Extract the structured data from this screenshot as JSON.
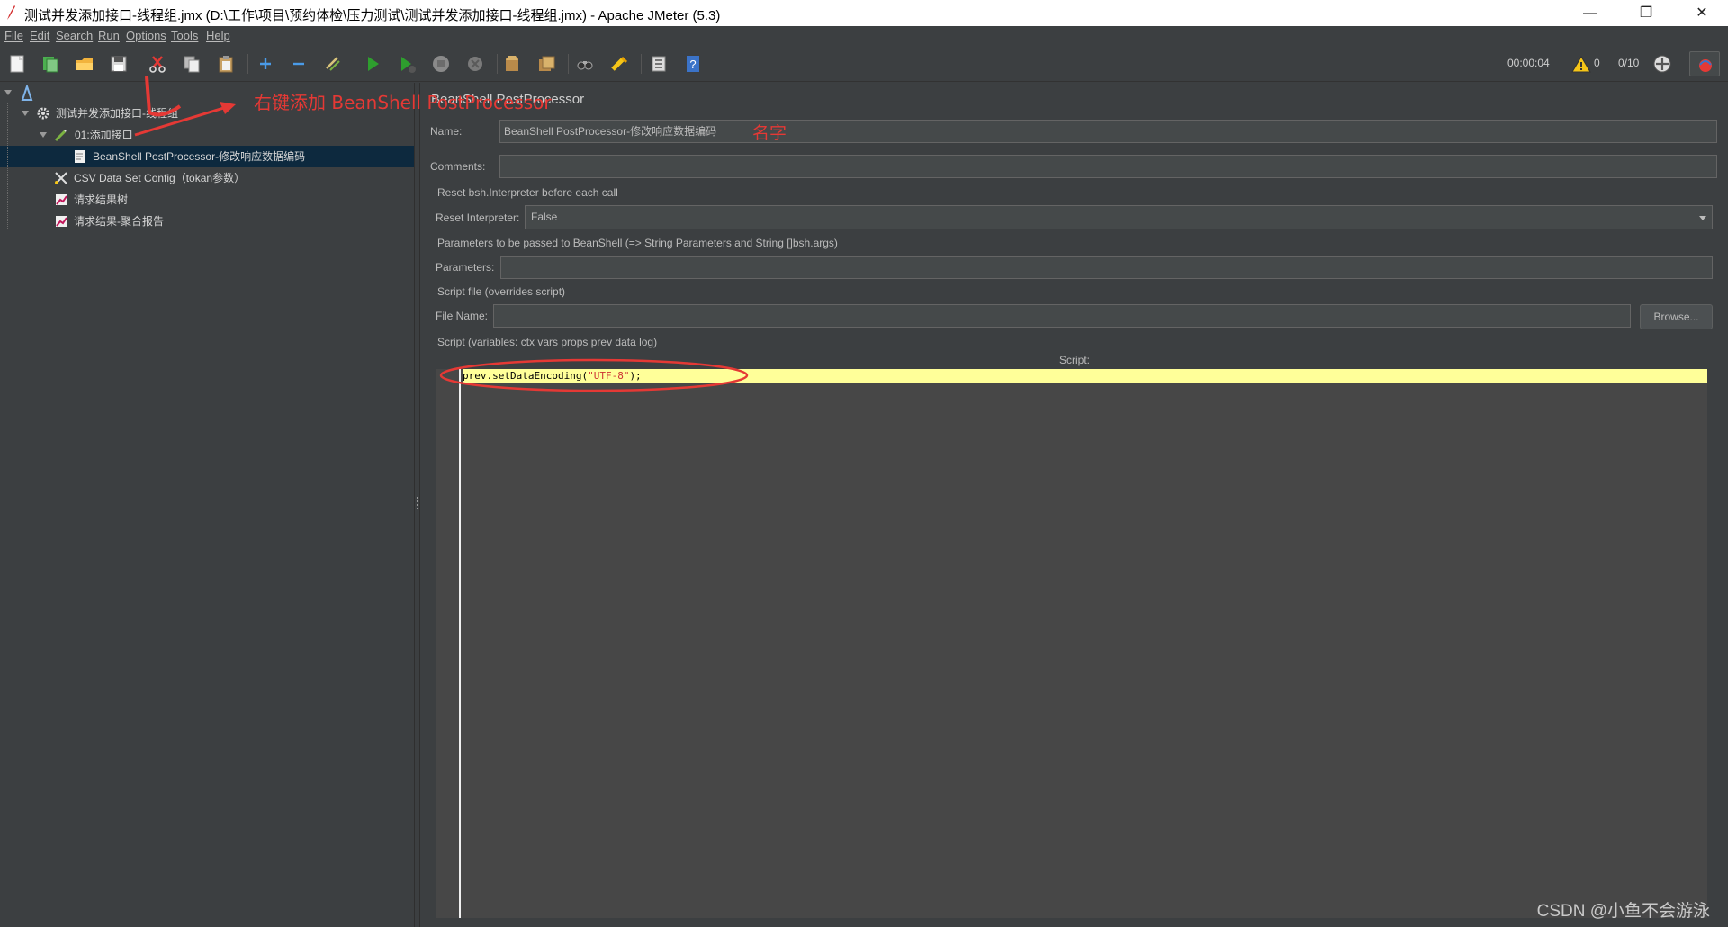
{
  "window": {
    "title": "测试并发添加接口-线程组.jmx (D:\\工作\\项目\\预约体检\\压力测试\\测试并发添加接口-线程组.jmx) - Apache JMeter (5.3)",
    "minimize_glyph": "—",
    "maximize_glyph": "❐",
    "close_glyph": "✕"
  },
  "menu": [
    "File",
    "Edit",
    "Search",
    "Run",
    "Options",
    "Tools",
    "Help"
  ],
  "toolbar": {
    "icons": [
      "new-icon",
      "templates-icon",
      "open-icon",
      "save-icon",
      "cut-icon",
      "copy-icon",
      "paste-icon",
      "expand-icon",
      "collapse-icon",
      "toggle-icon",
      "start-icon",
      "start-no-pause-icon",
      "stop-icon",
      "shutdown-icon",
      "clear-icon",
      "clear-all-icon",
      "search-icon",
      "reset-search-icon",
      "function-helper-icon",
      "help-icon"
    ],
    "timer": "00:00:04",
    "warnings": "0",
    "threads": "0/10"
  },
  "tree": {
    "root_icon": "test-plan-icon",
    "items": [
      {
        "label": "测试并发添加接口-线程组",
        "icon": "gear-icon"
      },
      {
        "label": "01:添加接口",
        "icon": "sampler-pencil-icon"
      },
      {
        "label": "BeanShell PostProcessor-修改响应数据编码",
        "icon": "postprocessor-doc-icon"
      },
      {
        "label": "CSV Data Set Config（tokan参数）",
        "icon": "config-scissors-icon"
      },
      {
        "label": "请求结果树",
        "icon": "listener-chart-icon"
      },
      {
        "label": "请求结果-聚合报告",
        "icon": "listener-chart-icon"
      }
    ]
  },
  "panel": {
    "heading": "BeanShell PostProcessor",
    "name_label": "Name:",
    "name_value": "BeanShell PostProcessor-修改响应数据编码",
    "comments_label": "Comments:",
    "comments_value": "",
    "reset_section": "Reset bsh.Interpreter before each call",
    "reset_label": "Reset Interpreter:",
    "reset_value": "False",
    "params_section": "Parameters to be passed to BeanShell (=> String Parameters and String []bsh.args)",
    "params_label": "Parameters:",
    "params_value": "",
    "file_section": "Script file (overrides script)",
    "file_label": "File Name:",
    "file_value": "",
    "browse_label": "Browse...",
    "script_section": "Script (variables: ctx vars props prev data log)",
    "script_label": "Script:",
    "script_code_prefix": "prev.setDataEncoding(",
    "script_code_string": "\"UTF-8\"",
    "script_code_suffix": ");"
  },
  "annotations": {
    "add_hint": "右键添加 BeanShell PostProcessor",
    "name_hint": "名字",
    "color": "#e53935"
  },
  "watermark": "CSDN @小鱼不会游泳"
}
